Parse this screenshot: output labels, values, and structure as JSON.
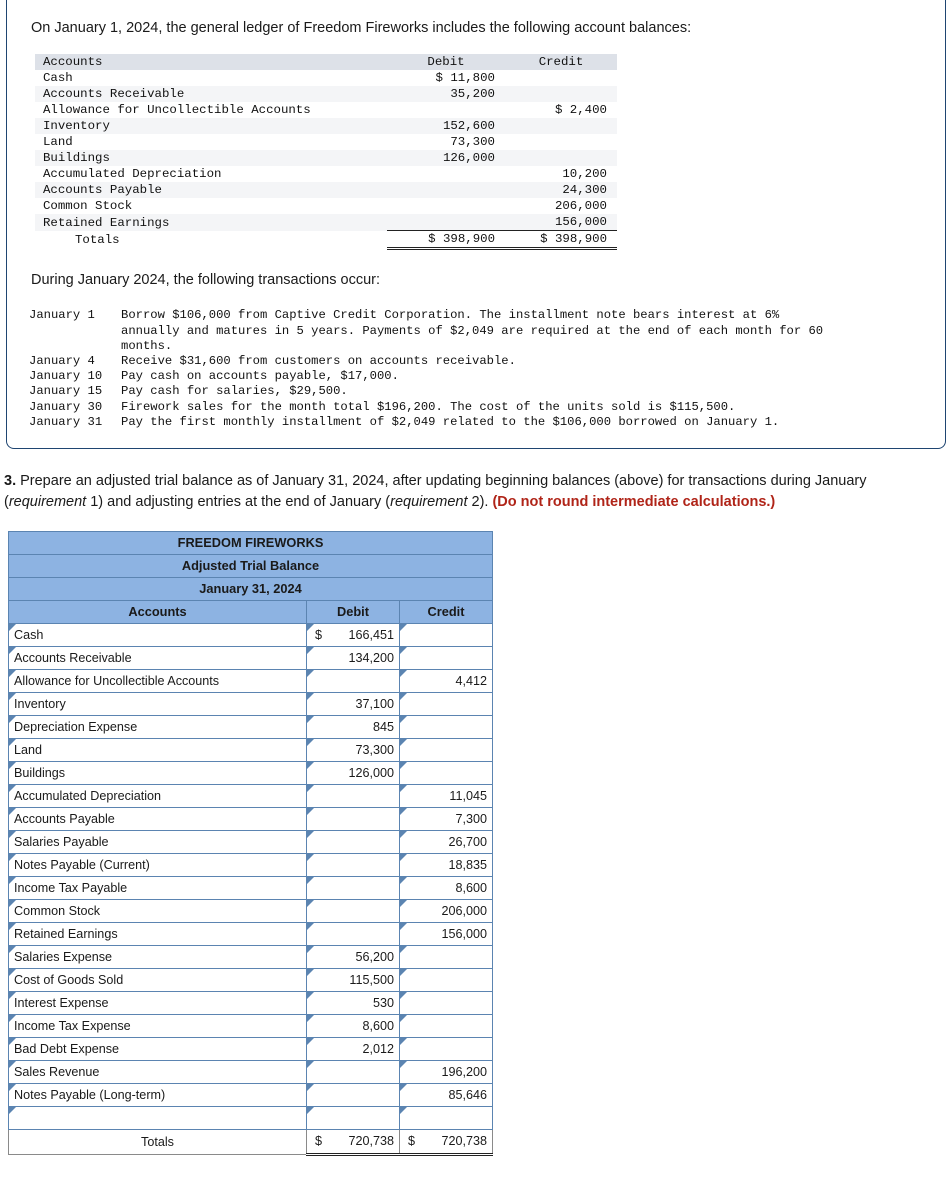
{
  "problem": {
    "intro": "On January 1, 2024, the general ledger of Freedom Fireworks includes the following account balances:",
    "during_line": "During January 2024, the following transactions occur:"
  },
  "opening_trial_balance": {
    "headers": [
      "Accounts",
      "Debit",
      "Credit"
    ],
    "rows": [
      {
        "account": "Cash",
        "debit": "$ 11,800",
        "credit": ""
      },
      {
        "account": "Accounts Receivable",
        "debit": "35,200",
        "credit": ""
      },
      {
        "account": "Allowance for Uncollectible Accounts",
        "debit": "",
        "credit": "$ 2,400"
      },
      {
        "account": "Inventory",
        "debit": "152,600",
        "credit": ""
      },
      {
        "account": "Land",
        "debit": "73,300",
        "credit": ""
      },
      {
        "account": "Buildings",
        "debit": "126,000",
        "credit": ""
      },
      {
        "account": "Accumulated Depreciation",
        "debit": "",
        "credit": "10,200"
      },
      {
        "account": "Accounts Payable",
        "debit": "",
        "credit": "24,300"
      },
      {
        "account": "Common Stock",
        "debit": "",
        "credit": "206,000"
      },
      {
        "account": "Retained Earnings",
        "debit": "",
        "credit": "156,000"
      }
    ],
    "totals": {
      "label": "Totals",
      "debit": "$ 398,900",
      "credit": "$ 398,900"
    }
  },
  "transactions": [
    {
      "date": "January 1",
      "text": "Borrow $106,000 from Captive Credit Corporation. The installment note bears interest at 6%\nannually and matures in 5 years. Payments of $2,049 are required at the end of each month for 60\nmonths."
    },
    {
      "date": "January 4",
      "text": "Receive $31,600 from customers on accounts receivable."
    },
    {
      "date": "January 10",
      "text": "Pay cash on accounts payable, $17,000."
    },
    {
      "date": "January 15",
      "text": "Pay cash for salaries, $29,500."
    },
    {
      "date": "January 30",
      "text": "Firework sales for the month total $196,200. The cost of the units sold is $115,500."
    },
    {
      "date": "January 31",
      "text": "Pay the first monthly installment of $2,049 related to the $106,000 borrowed on January 1."
    }
  ],
  "requirement": {
    "number": "3.",
    "part1": " Prepare an adjusted trial balance as of January 31, 2024, after updating beginning balances (above) for transactions during January (",
    "italic1": "requirement",
    "after_italic1": " 1) and adjusting entries at the end of January (",
    "italic2": "requirement",
    "after_italic2": " 2). ",
    "red_note": "(Do not round intermediate calculations.)"
  },
  "adjusted_trial_balance": {
    "company": "FREEDOM FIREWORKS",
    "statement": "Adjusted Trial Balance",
    "date": "January 31, 2024",
    "headers": {
      "accounts": "Accounts",
      "debit": "Debit",
      "credit": "Credit"
    },
    "rows": [
      {
        "account": "Cash",
        "debit": "166,451",
        "debit_symbol": "$",
        "credit": "",
        "credit_symbol": ""
      },
      {
        "account": "Accounts Receivable",
        "debit": "134,200",
        "debit_symbol": "",
        "credit": "",
        "credit_symbol": ""
      },
      {
        "account": "Allowance for Uncollectible Accounts",
        "debit": "",
        "debit_symbol": "",
        "credit": "4,412",
        "credit_symbol": ""
      },
      {
        "account": "Inventory",
        "debit": "37,100",
        "debit_symbol": "",
        "credit": "",
        "credit_symbol": ""
      },
      {
        "account": "Depreciation Expense",
        "debit": "845",
        "debit_symbol": "",
        "credit": "",
        "credit_symbol": ""
      },
      {
        "account": "Land",
        "debit": "73,300",
        "debit_symbol": "",
        "credit": "",
        "credit_symbol": ""
      },
      {
        "account": "Buildings",
        "debit": "126,000",
        "debit_symbol": "",
        "credit": "",
        "credit_symbol": ""
      },
      {
        "account": "Accumulated Depreciation",
        "debit": "",
        "debit_symbol": "",
        "credit": "11,045",
        "credit_symbol": ""
      },
      {
        "account": "Accounts Payable",
        "debit": "",
        "debit_symbol": "",
        "credit": "7,300",
        "credit_symbol": ""
      },
      {
        "account": "Salaries Payable",
        "debit": "",
        "debit_symbol": "",
        "credit": "26,700",
        "credit_symbol": ""
      },
      {
        "account": "Notes Payable (Current)",
        "debit": "",
        "debit_symbol": "",
        "credit": "18,835",
        "credit_symbol": ""
      },
      {
        "account": "Income Tax Payable",
        "debit": "",
        "debit_symbol": "",
        "credit": "8,600",
        "credit_symbol": ""
      },
      {
        "account": "Common Stock",
        "debit": "",
        "debit_symbol": "",
        "credit": "206,000",
        "credit_symbol": ""
      },
      {
        "account": "Retained Earnings",
        "debit": "",
        "debit_symbol": "",
        "credit": "156,000",
        "credit_symbol": ""
      },
      {
        "account": "Salaries Expense",
        "debit": "56,200",
        "debit_symbol": "",
        "credit": "",
        "credit_symbol": ""
      },
      {
        "account": "Cost of Goods Sold",
        "debit": "115,500",
        "debit_symbol": "",
        "credit": "",
        "credit_symbol": ""
      },
      {
        "account": "Interest Expense",
        "debit": "530",
        "debit_symbol": "",
        "credit": "",
        "credit_symbol": ""
      },
      {
        "account": "Income Tax Expense",
        "debit": "8,600",
        "debit_symbol": "",
        "credit": "",
        "credit_symbol": ""
      },
      {
        "account": "Bad Debt Expense",
        "debit": "2,012",
        "debit_symbol": "",
        "credit": "",
        "credit_symbol": ""
      },
      {
        "account": "Sales Revenue",
        "debit": "",
        "debit_symbol": "",
        "credit": "196,200",
        "credit_symbol": ""
      },
      {
        "account": "Notes Payable (Long-term)",
        "debit": "",
        "debit_symbol": "",
        "credit": "85,646",
        "credit_symbol": ""
      },
      {
        "account": "",
        "debit": "",
        "debit_symbol": "",
        "credit": "",
        "credit_symbol": ""
      }
    ],
    "totals": {
      "label": "Totals",
      "debit": "720,738",
      "debit_symbol": "$",
      "credit": "720,738",
      "credit_symbol": "$"
    }
  }
}
